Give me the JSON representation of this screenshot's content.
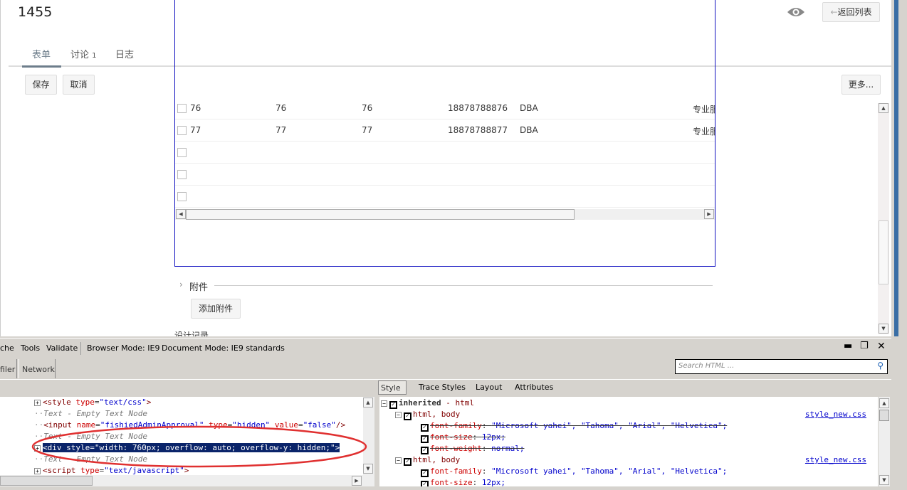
{
  "header": {
    "title": "1455",
    "back_label": "返回列表",
    "back_icon": "arrow-left-icon",
    "view_icon": "eye-icon"
  },
  "tabs": [
    {
      "label": "表单",
      "active": true
    },
    {
      "label": "讨论",
      "count": "1"
    },
    {
      "label": "日志"
    }
  ],
  "toolbar": {
    "save": "保存",
    "cancel": "取消",
    "more": "更多..."
  },
  "table": {
    "rows": [
      {
        "c1": "76",
        "c2": "76",
        "c3": "76",
        "phone": "18878788876",
        "role": "DBA",
        "dept": "专业服"
      },
      {
        "c1": "77",
        "c2": "77",
        "c3": "77",
        "phone": "18878788877",
        "role": "DBA",
        "dept": "专业服"
      },
      {},
      {},
      {}
    ]
  },
  "attachments": {
    "label": "附件",
    "add_button": "添加附件",
    "next_section_partial": "设计记录"
  },
  "devtools": {
    "menu": [
      "che",
      "Tools",
      "Validate"
    ],
    "browser_mode": "Browser Mode: IE9",
    "document_mode": "Document Mode: IE9 standards",
    "tabs": [
      "filer",
      "Network"
    ],
    "search_placeholder": "Search HTML ...",
    "right_tabs": [
      "Style",
      "Trace Styles",
      "Layout",
      "Attributes"
    ],
    "html_tree": [
      {
        "type": "tag",
        "expand": "+",
        "tag": "<style",
        "attrs": [
          {
            "n": "type",
            "v": "\"text/css\""
          }
        ],
        "end": ">"
      },
      {
        "type": "text",
        "text": "Text - Empty Text Node"
      },
      {
        "type": "tag",
        "expand": "",
        "tag": "<input",
        "attrs": [
          {
            "n": "name",
            "v": "\"fishiedAdminApproval\""
          },
          {
            "n": "type",
            "v": "\"hidden\""
          },
          {
            "n": "value",
            "v": "\"false\""
          }
        ],
        "end": "/>"
      },
      {
        "type": "text",
        "text": "Text - Empty Text Node"
      },
      {
        "type": "selected",
        "expand": "+",
        "text": "<div style=\"width: 760px; overflow: auto; overflow-y: hidden;\">"
      },
      {
        "type": "text",
        "text": "Text - Empty Text Node"
      },
      {
        "type": "tag",
        "expand": "+",
        "tag": "<script",
        "attrs": [
          {
            "n": "type",
            "v": "\"text/javascript\""
          }
        ],
        "end": ">"
      }
    ],
    "styles": {
      "inherited": "inherited",
      "inherited_from": "- html",
      "rules": [
        {
          "selector": "html, body",
          "source": "style_new.css",
          "props": [
            {
              "n": "font-family",
              "v": "\"Microsoft yahei\", \"Tahoma\", \"Arial\", \"Helvetica\";",
              "struck": true
            },
            {
              "n": "font-size",
              "v": "12px;",
              "struck": true
            },
            {
              "n": "font-weight",
              "v": "normal;",
              "struck": true
            }
          ]
        },
        {
          "selector": "html, body",
          "source": "style_new.css",
          "props": [
            {
              "n": "font-family",
              "v": "\"Microsoft yahei\", \"Tahoma\", \"Arial\", \"Helvetica\";",
              "struck": false
            },
            {
              "n": "font-size",
              "v": "12px;",
              "struck": false
            }
          ]
        }
      ]
    },
    "annotation_color": "#e03030",
    "selection_color": "#0a246a"
  }
}
